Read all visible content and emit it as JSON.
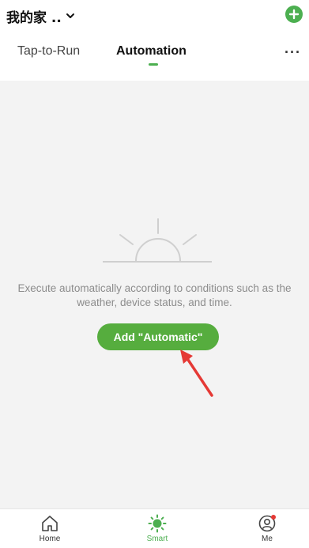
{
  "header": {
    "home_name": "我的家 ..",
    "add_icon": "plus-circle-icon"
  },
  "tabs": [
    {
      "label": "Tap-to-Run",
      "active": false
    },
    {
      "label": "Automation",
      "active": true
    }
  ],
  "more_label": "···",
  "empty_state": {
    "illustration": "sunrise-icon",
    "message": "Execute automatically according to conditions such as the weather, device status, and time.",
    "button_label": "Add \"Automatic\""
  },
  "bottom_nav": [
    {
      "label": "Home",
      "icon": "home-icon",
      "active": false
    },
    {
      "label": "Smart",
      "icon": "sun-icon",
      "active": true
    },
    {
      "label": "Me",
      "icon": "user-icon",
      "active": false
    }
  ],
  "colors": {
    "accent": "#4caf50",
    "button": "#56ad3e",
    "arrow": "#e53935",
    "background": "#f3f3f3"
  }
}
